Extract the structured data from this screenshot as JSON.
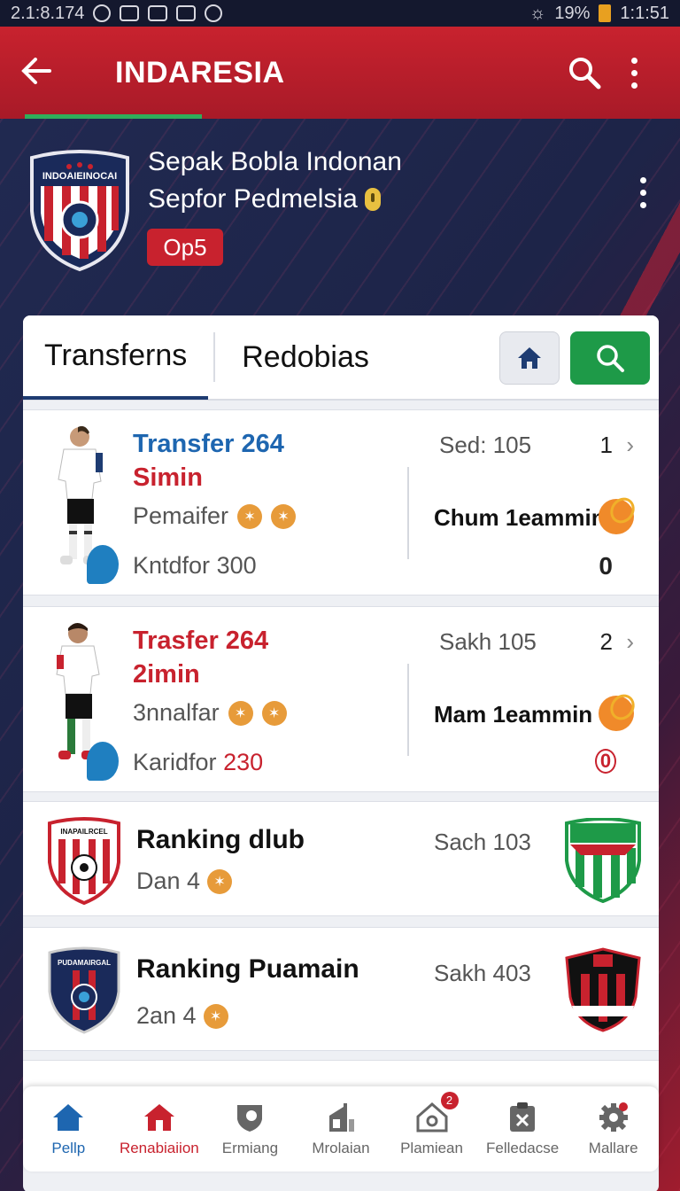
{
  "status_bar": {
    "left_text": "2.1:8.174",
    "battery": "19%",
    "time": "1:1:51"
  },
  "app_bar": {
    "title": "INDARESIA"
  },
  "club": {
    "name_line1": "Sepak Bobla Indonan",
    "name_line2": "Sepfor Pedmelsia",
    "tag": "Op5",
    "crest_text": "INDOAIEINOCAI"
  },
  "tabs": [
    {
      "label": "Transferns"
    },
    {
      "label": "Redobias"
    }
  ],
  "transfers": [
    {
      "title_line1": "Transfer 264",
      "title_line2": "Simin",
      "role": "Pemaifer",
      "fee_label": "Kntdfor",
      "fee_value": "300",
      "stat": "Sed: 105",
      "rank": "1",
      "team": "Chum 1eammin",
      "count": "0"
    },
    {
      "title_line1": "Trasfer 264",
      "title_line2": "2imin",
      "role": "3nnalfar",
      "fee_label": "Karidfor",
      "fee_value": "230",
      "stat": "Sakh 105",
      "rank": "2",
      "team": "Mam 1eammin",
      "count": "0"
    }
  ],
  "rankings": [
    {
      "title": "Ranking dlub",
      "sub": "Dan 4",
      "stat": "Sach 103",
      "crest_text": "INAPAILRCEL"
    },
    {
      "title": "Ranking Puamain",
      "sub": "2an 4",
      "stat": "Sakh 403",
      "crest_text": "PUDAMAIRGAL"
    }
  ],
  "bottom_nav": [
    {
      "label": "Pellp"
    },
    {
      "label": "Renabiaiion"
    },
    {
      "label": "Ermiang"
    },
    {
      "label": "Mrolaian"
    },
    {
      "label": "Plamiean",
      "badge": "2"
    },
    {
      "label": "Felledacse"
    },
    {
      "label": "Mallare"
    }
  ],
  "colors": {
    "primary_red": "#c8222e",
    "accent_green": "#1e9a48",
    "link_blue": "#1e66b0",
    "navy": "#1e3c72"
  }
}
